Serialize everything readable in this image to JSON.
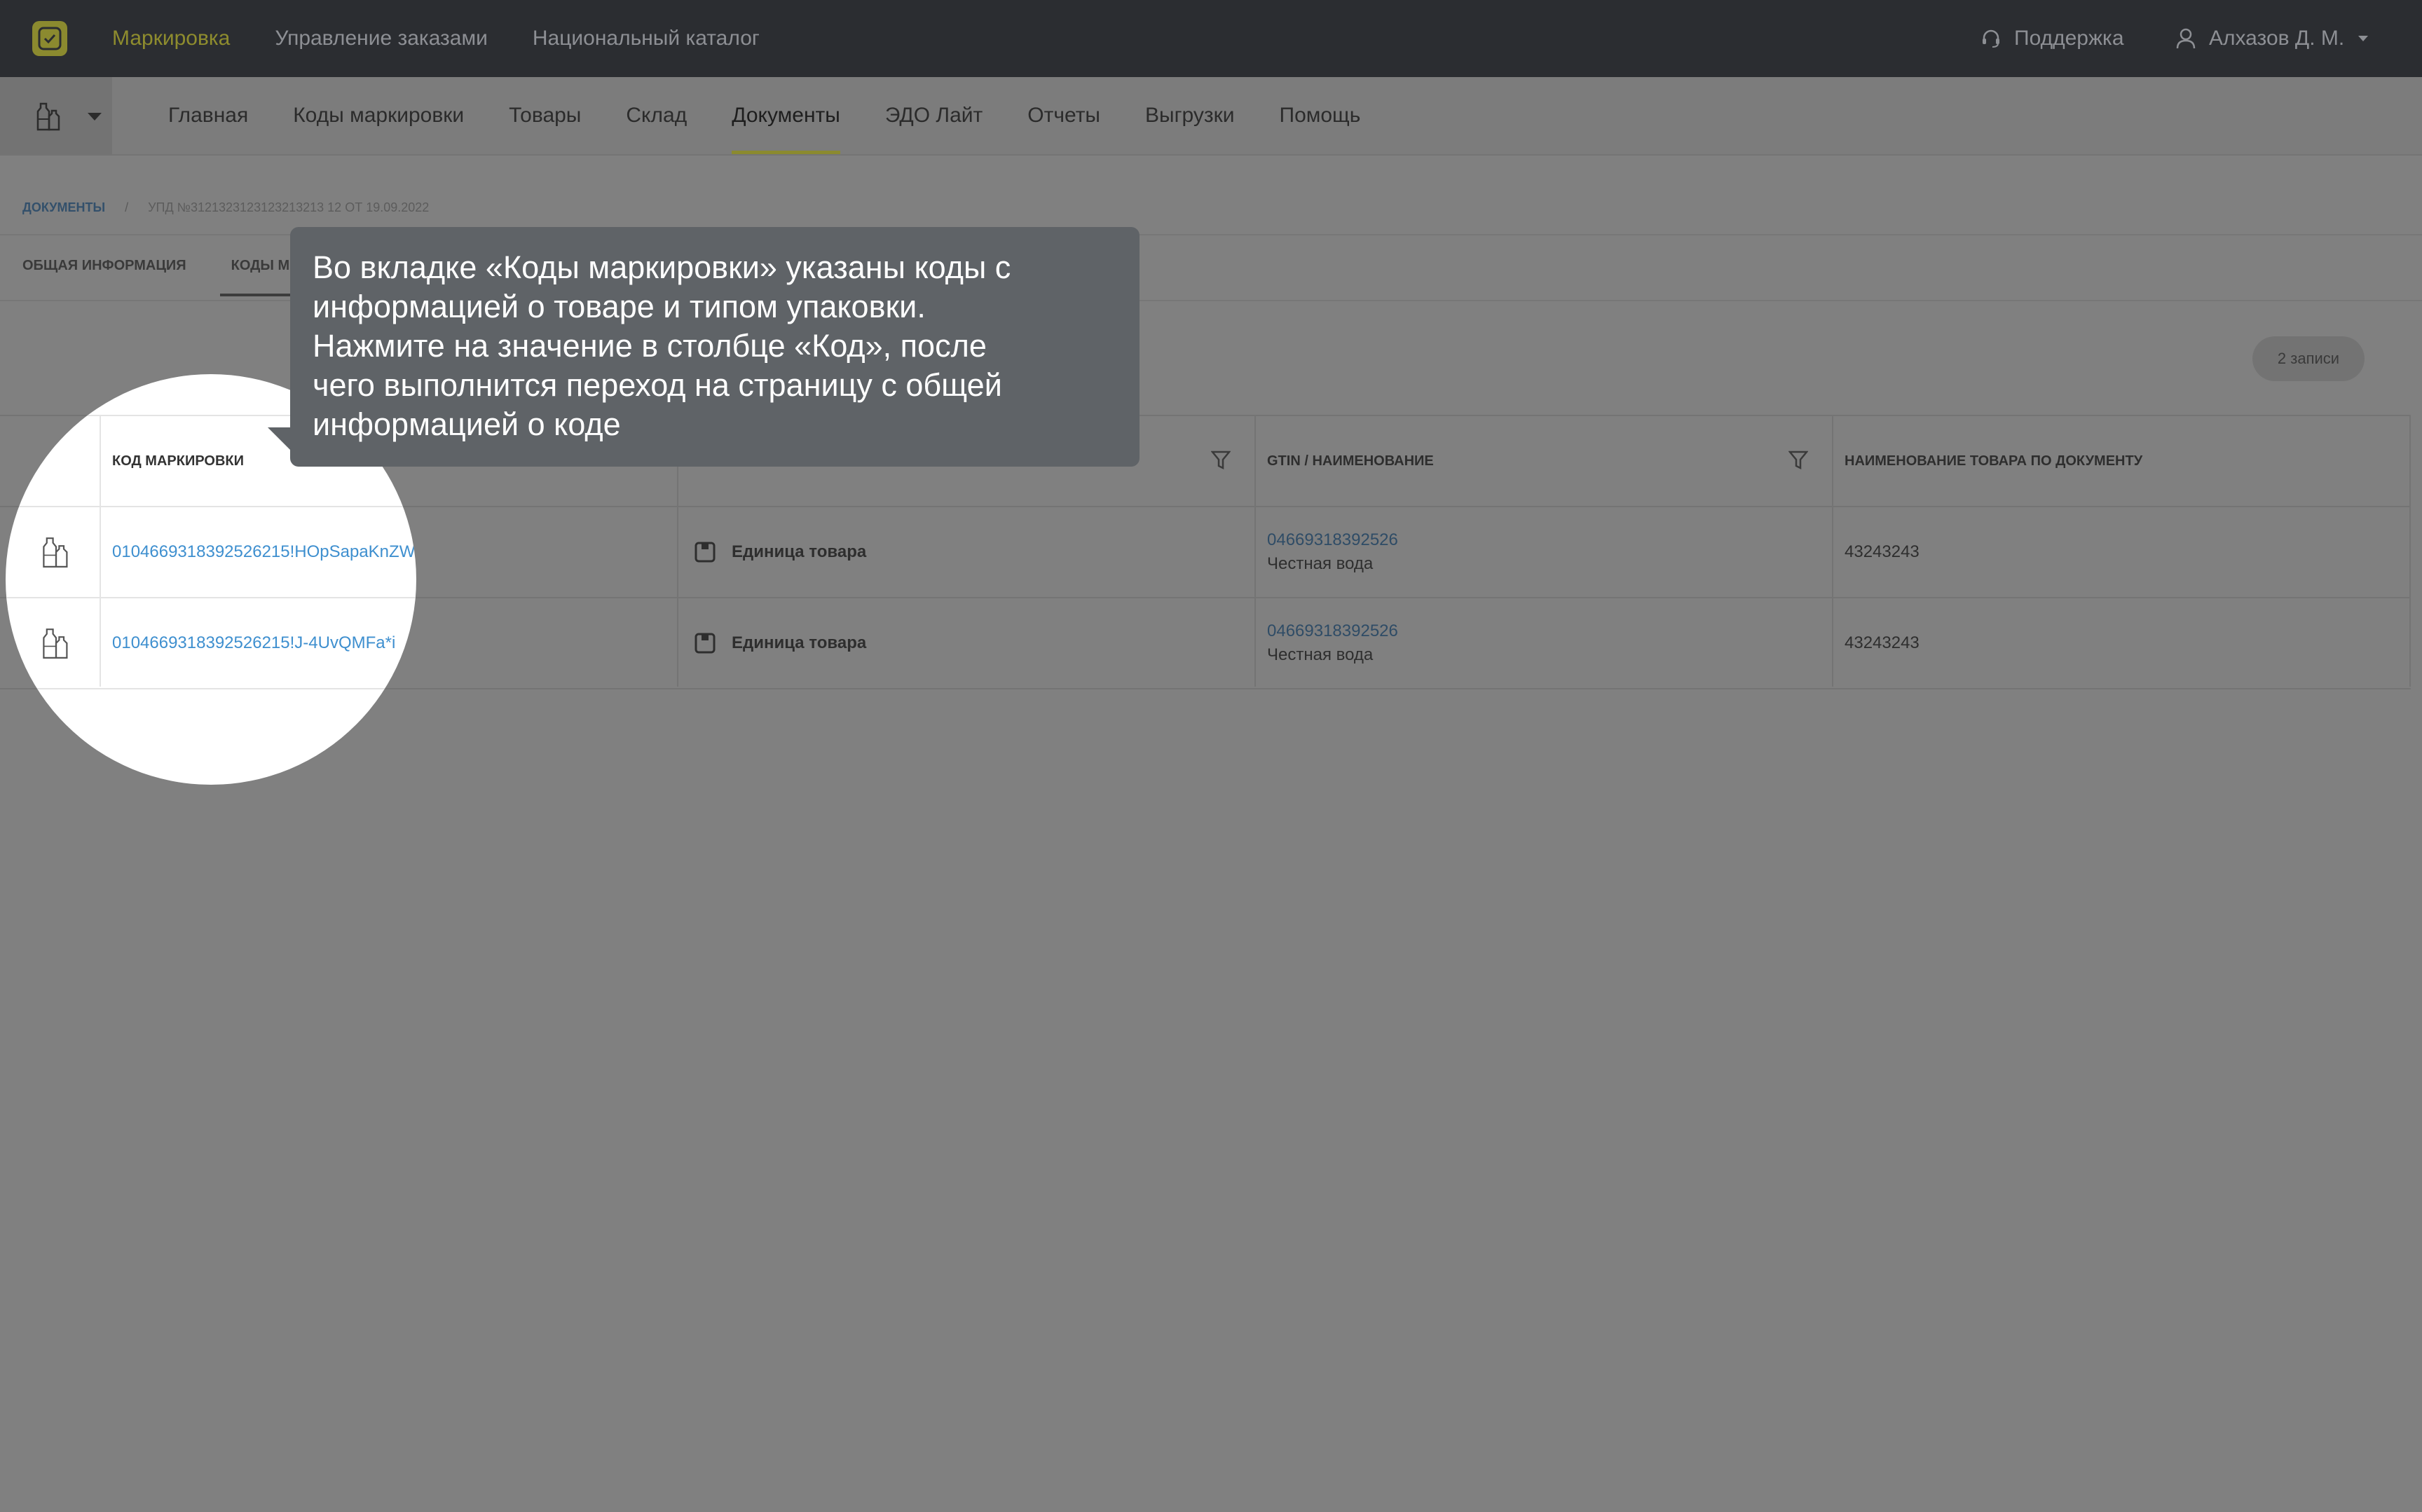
{
  "topbar": {
    "brand_icon": "marking-logo-icon",
    "nav": [
      "Маркировка",
      "Управление заказами",
      "Национальный каталог"
    ],
    "support_label": "Поддержка",
    "user_name": "Алхазов Д. М."
  },
  "subnav": {
    "product_icon": "bottles-icon",
    "links": [
      "Главная",
      "Коды маркировки",
      "Товары",
      "Склад",
      "Документы",
      "ЭДО Лайт",
      "Отчеты",
      "Выгрузки",
      "Помощь"
    ],
    "active": "Документы"
  },
  "breadcrumb": {
    "root": "Документы",
    "current": "УПД №3121323123123213213 12 от 19.09.2022"
  },
  "doc_tabs": {
    "general": "Общая информация",
    "codes": "Коды м"
  },
  "records_badge": "2 записи",
  "table": {
    "headers": {
      "code": "Код маркировки",
      "gtin": "GTIN / наименование",
      "doc_name": "Наименование товара по документу"
    },
    "rows": [
      {
        "code": "0104669318392526215!HOpSapaKnZW",
        "package": "Единица товара",
        "gtin": "04669318392526",
        "product": "Честная вода",
        "doc_name": "43243243"
      },
      {
        "code": "0104669318392526215!J-4UvQMFa*i",
        "package": "Единица товара",
        "gtin": "04669318392526",
        "product": "Честная вода",
        "doc_name": "43243243"
      }
    ]
  },
  "tooltip": {
    "text": "Во вкладке «Коды маркировки» указаны коды с\nинформацией о товаре и типом упаковки.\nНажмите на значение в столбце «Код», после\nчего выполнится переход на страницу с общей\nинформацией о коде"
  },
  "colors": {
    "accent": "#f0ee52",
    "overlay": "#808080",
    "link": "#3e8fcf",
    "tooltip_bg": "#5f6367"
  }
}
